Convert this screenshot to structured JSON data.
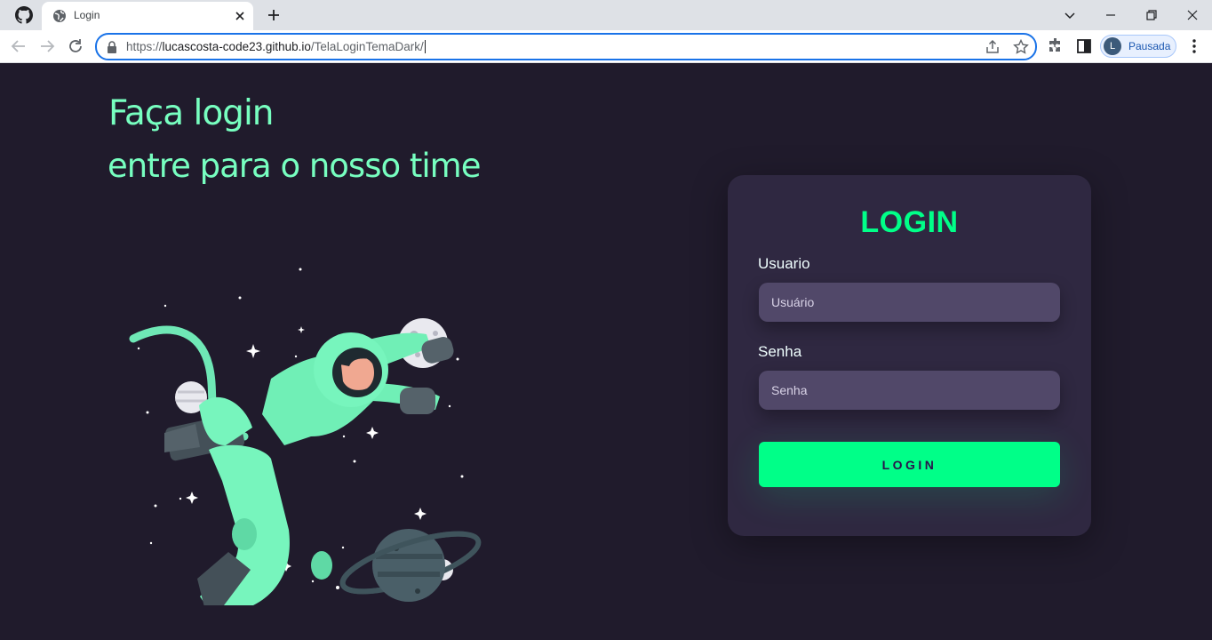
{
  "browser": {
    "tab_title": "Login",
    "url_prefix": "https://",
    "url_host": "lucascosta-code23.github.io",
    "url_path": "/TelaLoginTemaDark/",
    "profile_initial": "L",
    "profile_label": "Pausada"
  },
  "hero": {
    "headline": "Faça login",
    "subline": "entre para o nosso time"
  },
  "login_card": {
    "title": "LOGIN",
    "username_label": "Usuario",
    "username_placeholder": "Usuário",
    "password_label": "Senha",
    "password_placeholder": "Senha",
    "button_label": "LOGIN"
  },
  "colors": {
    "background": "#201b2c",
    "card": "#2f2841",
    "input": "#514869",
    "accent": "#00ff88",
    "headline": "#77ffc0"
  }
}
